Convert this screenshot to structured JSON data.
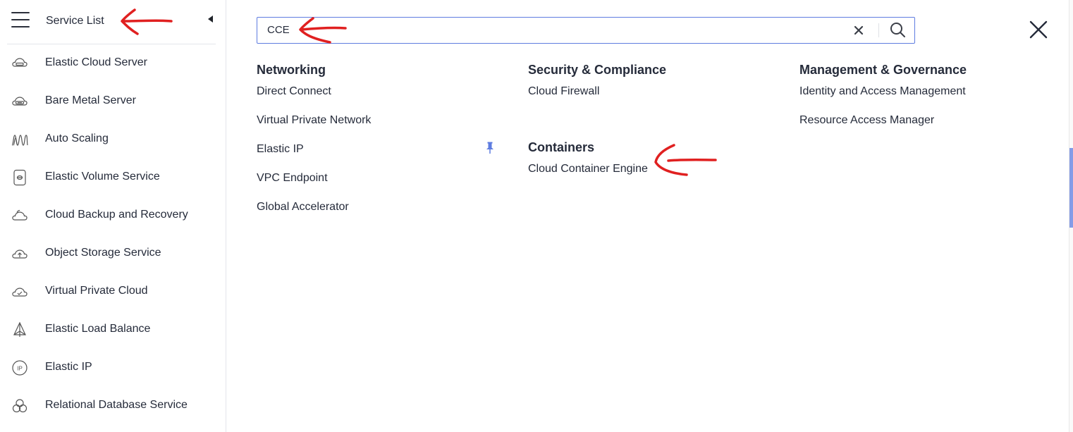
{
  "sidebar": {
    "title": "Service List",
    "items": [
      {
        "label": "Elastic Cloud Server",
        "icon": "cloud-server-icon"
      },
      {
        "label": "Bare Metal Server",
        "icon": "bare-metal-icon"
      },
      {
        "label": "Auto Scaling",
        "icon": "auto-scaling-icon"
      },
      {
        "label": "Elastic Volume Service",
        "icon": "volume-icon"
      },
      {
        "label": "Cloud Backup and Recovery",
        "icon": "cloud-backup-icon"
      },
      {
        "label": "Object Storage Service",
        "icon": "object-storage-icon"
      },
      {
        "label": "Virtual Private Cloud",
        "icon": "vpc-icon"
      },
      {
        "label": "Elastic Load Balance",
        "icon": "load-balance-icon"
      },
      {
        "label": "Elastic IP",
        "icon": "ip-icon"
      },
      {
        "label": "Relational Database Service",
        "icon": "database-icon"
      }
    ]
  },
  "search": {
    "value": "CCE",
    "accent": "#5e7ce0"
  },
  "categories": [
    {
      "title": "Networking",
      "items": [
        "Direct Connect",
        "Virtual Private Network",
        "Elastic IP",
        "VPC Endpoint",
        "Global Accelerator"
      ]
    },
    {
      "title": "Security & Compliance",
      "items": [
        "Cloud Firewall"
      ]
    },
    {
      "title": "Containers",
      "items": [
        "Cloud Container Engine"
      ]
    },
    {
      "title": "Management & Governance",
      "items": [
        "Identity and Access Management",
        "Resource Access Manager"
      ]
    }
  ],
  "colors": {
    "text": "#252b3a",
    "pin": "#5e7ce0",
    "annotation": "#e02020"
  }
}
